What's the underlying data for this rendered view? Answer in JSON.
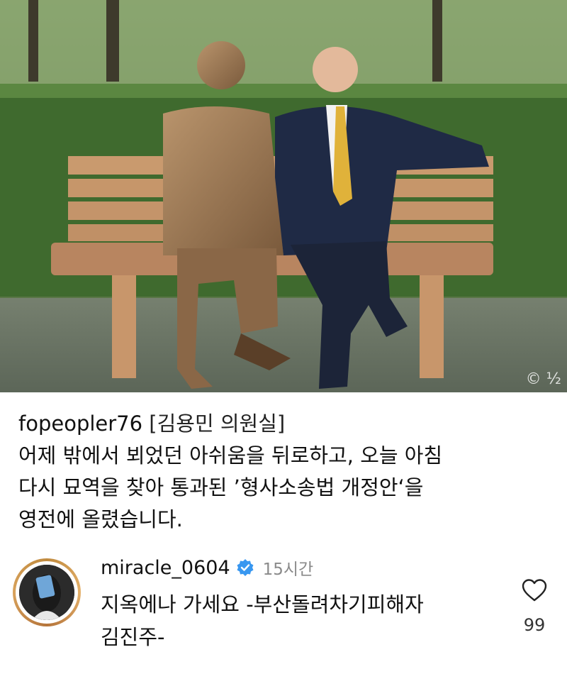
{
  "photo": {
    "description_icon": "statue-bench-photo",
    "watermark": "© ½"
  },
  "caption": {
    "username": "fopeopler76",
    "tag": "[김용민 의원실]",
    "lines": [
      "어제 밖에서 뵈었던 아쉬움을 뒤로하고, 오늘 아침",
      "다시 묘역을 찾아 통과된 ’형사소송법 개정안‘을",
      "영전에 올렸습니다."
    ]
  },
  "comment": {
    "username": "miracle_0604",
    "verified_icon": "verified-badge-icon",
    "time": "15시간",
    "lines": [
      "지옥에나 가세요 -부산돌려차기피해자",
      "김진주-"
    ],
    "like_icon": "heart-icon",
    "like_count": "99"
  },
  "colors": {
    "verified": "#3897f0",
    "muted": "#8a8a8a",
    "avatar_ring": "#c08a3e"
  }
}
